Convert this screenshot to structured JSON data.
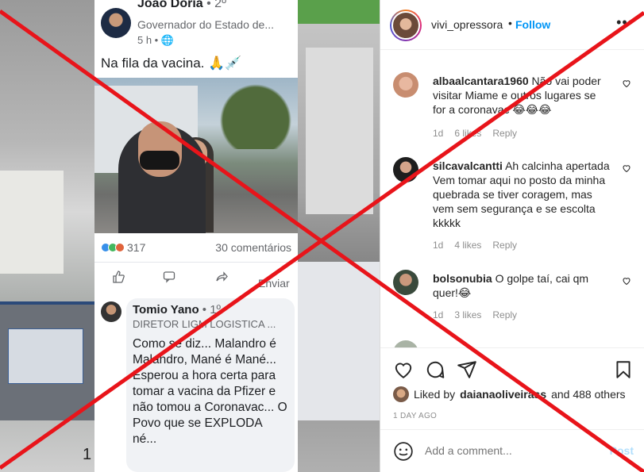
{
  "facebook_post": {
    "author": "João Doria",
    "degree": " • 2º",
    "role": "Governador do Estado de...",
    "time": "5 h • ",
    "text": "Na fila da vacina. 🙏💉",
    "reaction_count": "317",
    "comments_count": "30 comentários",
    "share_label": "Enviar",
    "comment": {
      "author": "Tomio Yano",
      "degree": " • 1º",
      "role": "DIRETOR LIGM LOGISTICA ...",
      "text": "Como se diz... Malandro é Malandro, Mané é Mané... Esperou a hora certa para tomar a vacina da Pfizer e não tomou a Coronavac... O Povo que se EXPLODA né..."
    }
  },
  "background": {
    "bottom_number": "1"
  },
  "instagram": {
    "username": "vivi_opressora",
    "dot": "•",
    "follow_label": "Follow",
    "comments": [
      {
        "user": "albaalcantara1960",
        "text": "Não vai poder visitar Miame e outros lugares se for a coronavac 😂😂😂",
        "time": "1d",
        "likes": "6 likes",
        "reply": "Reply"
      },
      {
        "user": "silcavalcantti",
        "text": "Ah calcinha apertada Vem tomar aqui no posto da minha quebrada se tiver coragem, mas vem sem segurança e se escolta kkkkk",
        "time": "1d",
        "likes": "4 likes",
        "reply": "Reply"
      },
      {
        "user": "bolsonubia",
        "text": "O golpe taí, cai qm quer!😂",
        "time": "1d",
        "likes": "3 likes",
        "reply": "Reply"
      }
    ],
    "liked_by_prefix": "Liked by",
    "liked_by_user": "daianaoliveirass",
    "liked_by_suffix": "and 488 others",
    "date": "1 DAY AGO",
    "add_comment_placeholder": "Add a comment...",
    "post_label": "Post"
  },
  "colors": {
    "overlay_x": "#e8141a",
    "follow_blue": "#0095f6"
  }
}
